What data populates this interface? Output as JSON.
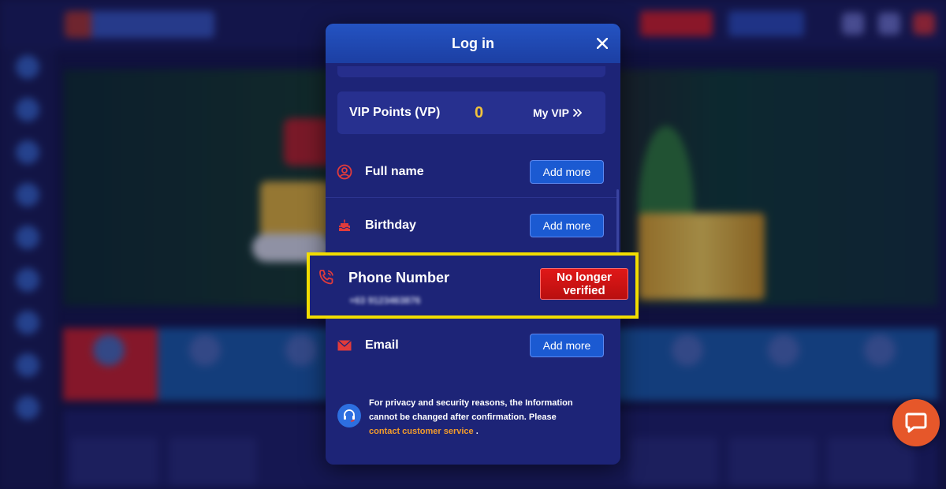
{
  "modal": {
    "title": "Log in",
    "vip": {
      "label": "VIP Points (VP)",
      "value": "0",
      "link_label": "My VIP"
    },
    "rows": [
      {
        "label": "Full name",
        "button": "Add more",
        "icon": "user-circle-icon"
      },
      {
        "label": "Birthday",
        "button": "Add more",
        "icon": "cake-icon"
      },
      {
        "label": "Phone Number",
        "value": "+63 9123463876",
        "status": "No longer verified",
        "icon": "phone-icon"
      },
      {
        "label": "Email",
        "button": "Add more",
        "icon": "envelope-icon"
      }
    ],
    "notice": {
      "text": "For privacy and security reasons, the Information cannot be changed after confirmation. Please",
      "link": "contact customer service",
      "suffix": ".",
      "icon": "headset-icon"
    }
  },
  "colors": {
    "modal_bg": "#1d2477",
    "header_bg": "#2453c2",
    "accent_gold": "#f2c33b",
    "highlight": "#f2dd00",
    "status_red": "#e01818",
    "link_orange": "#f39c2b",
    "chat_orange": "#e6572a"
  },
  "chat": {
    "icon": "chat-bubble-icon"
  }
}
